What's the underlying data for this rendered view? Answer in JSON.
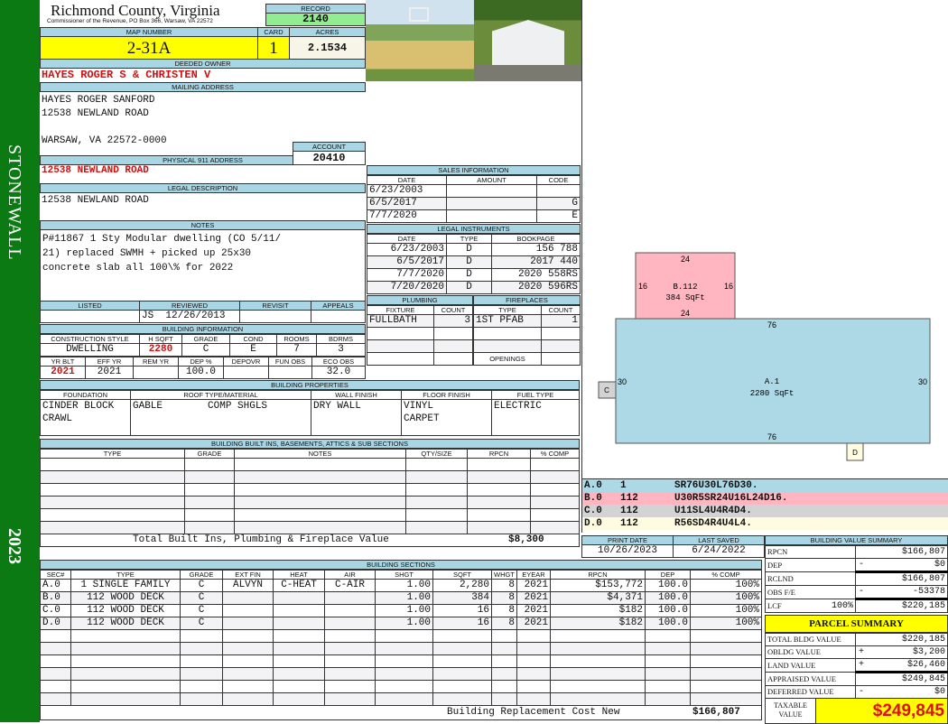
{
  "sidebar": {
    "district": "STONEWALL",
    "year": "2023"
  },
  "header": {
    "title": "Richmond County, Virginia",
    "subtitle": "Commissioner of the Revenue, PO Box 366, Warsaw, VA 22572",
    "record_label": "RECORD",
    "record": "2140",
    "map_label": "MAP NUMBER",
    "map_number": "2-31A",
    "card_label": "CARD",
    "card": "1",
    "acres_label": "ACRES",
    "acres": "2.1534"
  },
  "owner": {
    "label": "DEEDED OWNER",
    "value": "HAYES ROGER S & CHRISTEN V"
  },
  "mailing": {
    "label": "MAILING ADDRESS",
    "lines": [
      "HAYES ROGER SANFORD",
      "12538 NEWLAND ROAD",
      "",
      "WARSAW, VA 22572-0000"
    ],
    "account_label": "ACCOUNT",
    "account": "20410"
  },
  "physical": {
    "label": "PHYSICAL 911 ADDRESS",
    "value": "12538 NEWLAND ROAD"
  },
  "legal": {
    "label": "LEGAL DESCRIPTION",
    "value": "12538 NEWLAND ROAD"
  },
  "notes": {
    "label": "NOTES",
    "lines": [
      "P#11867 1 Sty Modular dwelling (CO 5/11/",
      "21) replaced SWMH + picked up 25x30",
      "concrete slab all 100\\% for 2022"
    ]
  },
  "review": {
    "headers": [
      "LISTED",
      "REVIEWED",
      "REVISIT",
      "APPEALS"
    ],
    "listed": "",
    "reviewed_by": "JS",
    "reviewed_date": "12/26/2013",
    "revisit": "",
    "appeals": ""
  },
  "building_info": {
    "label": "BUILDING INFORMATION",
    "headers1": [
      "CONSTRUCTION STYLE",
      "H SQFT",
      "GRADE",
      "COND",
      "ROOMS",
      "BDRMS"
    ],
    "style": "DWELLING",
    "hsqft": "2280",
    "grade": "C",
    "cond": "E",
    "rooms": "7",
    "bdrms": "3",
    "headers2": [
      "YR BLT",
      "EFF YR",
      "REM YR",
      "DEP %",
      "DEPOVR",
      "FUN OBS",
      "ECO OBS"
    ],
    "yr_blt": "2021",
    "eff_yr": "2021",
    "rem_yr": "",
    "dep": "100.0",
    "depovr": "",
    "fun_obs": "",
    "eco_obs": "32.0"
  },
  "building_props": {
    "label": "BUILDING PROPERTIES",
    "headers": [
      "FOUNDATION",
      "ROOF TYPE/MATERIAL",
      "WALL FINISH",
      "FLOOR FINISH",
      "FUEL TYPE"
    ],
    "foundation": [
      "CINDER BLOCK",
      "CRAWL"
    ],
    "roof_type": "GABLE",
    "roof_material": "COMP SHGLS",
    "wall": "DRY WALL",
    "floor": [
      "VINYL",
      "CARPET"
    ],
    "fuel": "ELECTRIC"
  },
  "built_ins": {
    "label": "BUILDING BUILT INS, BASEMENTS, ATTICS & SUB SECTIONS",
    "headers": [
      "TYPE",
      "GRADE",
      "NOTES",
      "QTY/SIZE",
      "RPCN",
      "% COMP"
    ],
    "total_label": "Total Built Ins, Plumbing & Fireplace Value",
    "total": "$8,300"
  },
  "sales": {
    "label": "SALES INFORMATION",
    "headers": [
      "DATE",
      "AMOUNT",
      "CODE"
    ],
    "rows": [
      {
        "date": "6/23/2003",
        "amount": "",
        "code": ""
      },
      {
        "date": "6/5/2017",
        "amount": "",
        "code": "G"
      },
      {
        "date": "7/7/2020",
        "amount": "",
        "code": "E"
      }
    ]
  },
  "instruments": {
    "label": "LEGAL INSTRUMENTS",
    "headers": [
      "DATE",
      "TYPE",
      "BOOKPAGE"
    ],
    "rows": [
      {
        "date": "6/23/2003",
        "type": "D",
        "book": "156 788"
      },
      {
        "date": "6/5/2017",
        "type": "D",
        "book": "2017 440"
      },
      {
        "date": "7/7/2020",
        "type": "D",
        "book": "2020 558RS"
      },
      {
        "date": "7/20/2020",
        "type": "D",
        "book": "2020 596RS"
      }
    ]
  },
  "plumbing": {
    "label": "PLUMBING",
    "headers": [
      "FIXTURE",
      "COUNT"
    ],
    "fixture": "FULLBATH",
    "count": "3"
  },
  "fireplaces": {
    "label": "FIREPLACES",
    "headers": [
      "TYPE",
      "COUNT"
    ],
    "type": "1ST PFAB",
    "count": "1",
    "openings_label": "OPENINGS",
    "openings": ""
  },
  "sections": {
    "label": "BUILDING SECTIONS",
    "headers": [
      "SEC#",
      "TYPE",
      "GRADE",
      "EXT FIN",
      "HEAT",
      "AIR",
      "SHGT",
      "SQFT",
      "WHGT",
      "EYEAR",
      "RPCN",
      "DEP",
      "% COMP"
    ],
    "rows": [
      {
        "sec": "A.0",
        "type": "1 SINGLE FAMILY",
        "grade": "C",
        "ext": "ALVYN",
        "heat": "C-HEAT",
        "air": "C-AIR",
        "shgt": "1.00",
        "sqft": "2,280",
        "whgt": "8",
        "eyear": "2021",
        "rpcn": "$153,772",
        "dep": "100.0",
        "comp": "100%"
      },
      {
        "sec": "B.0",
        "type": "112 WOOD DECK",
        "grade": "C",
        "ext": "",
        "heat": "",
        "air": "",
        "shgt": "1.00",
        "sqft": "384",
        "whgt": "8",
        "eyear": "2021",
        "rpcn": "$4,371",
        "dep": "100.0",
        "comp": "100%"
      },
      {
        "sec": "C.0",
        "type": "112 WOOD DECK",
        "grade": "C",
        "ext": "",
        "heat": "",
        "air": "",
        "shgt": "1.00",
        "sqft": "16",
        "whgt": "8",
        "eyear": "2021",
        "rpcn": "$182",
        "dep": "100.0",
        "comp": "100%"
      },
      {
        "sec": "D.0",
        "type": "112 WOOD DECK",
        "grade": "C",
        "ext": "",
        "heat": "",
        "air": "",
        "shgt": "1.00",
        "sqft": "16",
        "whgt": "8",
        "eyear": "2021",
        "rpcn": "$182",
        "dep": "100.0",
        "comp": "100%"
      }
    ],
    "total_label": "Building Replacement Cost New",
    "total": "$166,807"
  },
  "sketch": {
    "a": {
      "label": "A.1",
      "area": "2280 SqFt",
      "w": "76",
      "h": "30"
    },
    "b": {
      "label": "B.112",
      "area": "384 SqFt",
      "w": "24",
      "h": "16"
    },
    "c": "C",
    "d": "D",
    "codes": [
      {
        "sec": "A.0",
        "code": "1",
        "vec": "SR76U30L76D30.",
        "color": "#add8e6"
      },
      {
        "sec": "B.0",
        "code": "112",
        "vec": "U30R5SR24U16L24D16.",
        "color": "#ffb6c1"
      },
      {
        "sec": "C.0",
        "code": "112",
        "vec": "U11SL4U4R4D4.",
        "color": "#d3d3d3"
      },
      {
        "sec": "D.0",
        "code": "112",
        "vec": "R56SD4R4U4L4.",
        "color": "#fffbe0"
      }
    ]
  },
  "dates": {
    "print_label": "PRINT DATE",
    "print": "10/26/2023",
    "saved_label": "LAST SAVED",
    "saved": "6/24/2022"
  },
  "value_summary": {
    "label": "BUILDING VALUE SUMMARY",
    "rows": [
      {
        "k": "RPCN",
        "s": "",
        "v": "$166,807"
      },
      {
        "k": "DEP",
        "s": "-",
        "v": "$0"
      },
      {
        "k": "RCLND",
        "s": "",
        "v": "$166,807"
      },
      {
        "k": "OBS F/E",
        "s": "-",
        "v": "-53378"
      },
      {
        "k": "LCF",
        "p": "100%",
        "s": "",
        "v": "$220,185"
      }
    ]
  },
  "parcel": {
    "label": "PARCEL SUMMARY",
    "rows": [
      {
        "k": "TOTAL BLDG VALUE",
        "s": "",
        "v": "$220,185"
      },
      {
        "k": "OBLDG VALUE",
        "s": "+",
        "v": "$3,200"
      },
      {
        "k": "LAND VALUE",
        "s": "+",
        "v": "$26,460"
      },
      {
        "k": "APPRAISED VALUE",
        "s": "",
        "v": "$249,845"
      },
      {
        "k": "DEFERRED VALUE",
        "s": "-",
        "v": "$0"
      }
    ],
    "taxable_label": "TAXABLE VALUE",
    "taxable": "$249,845"
  }
}
